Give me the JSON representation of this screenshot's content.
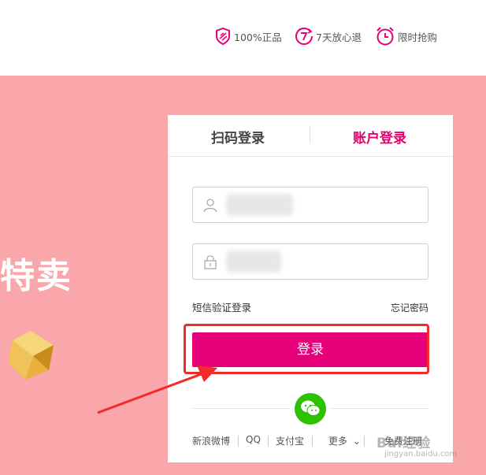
{
  "header": {
    "badges": [
      {
        "label": "100%正品",
        "icon": "shield-icon"
      },
      {
        "label": "7天放心退",
        "icon": "seven-day-return-icon"
      },
      {
        "label": "限时抢购",
        "icon": "alarm-clock-icon"
      }
    ]
  },
  "banner": {
    "slogan": "特卖",
    "background_color": "#f9a7ab"
  },
  "login": {
    "tabs": {
      "qr": "扫码登录",
      "account": "账户登录"
    },
    "sms_login": "短信验证登录",
    "forgot_password": "忘记密码",
    "submit": "登录",
    "accent_color": "#e5007a"
  },
  "social": {
    "weibo": "新浪微博",
    "qq": "QQ",
    "alipay": "支付宝",
    "more": "更多",
    "register": "免费注册"
  },
  "watermark": {
    "text": "Bai经验",
    "sub": "jingyan.baidu.com"
  }
}
